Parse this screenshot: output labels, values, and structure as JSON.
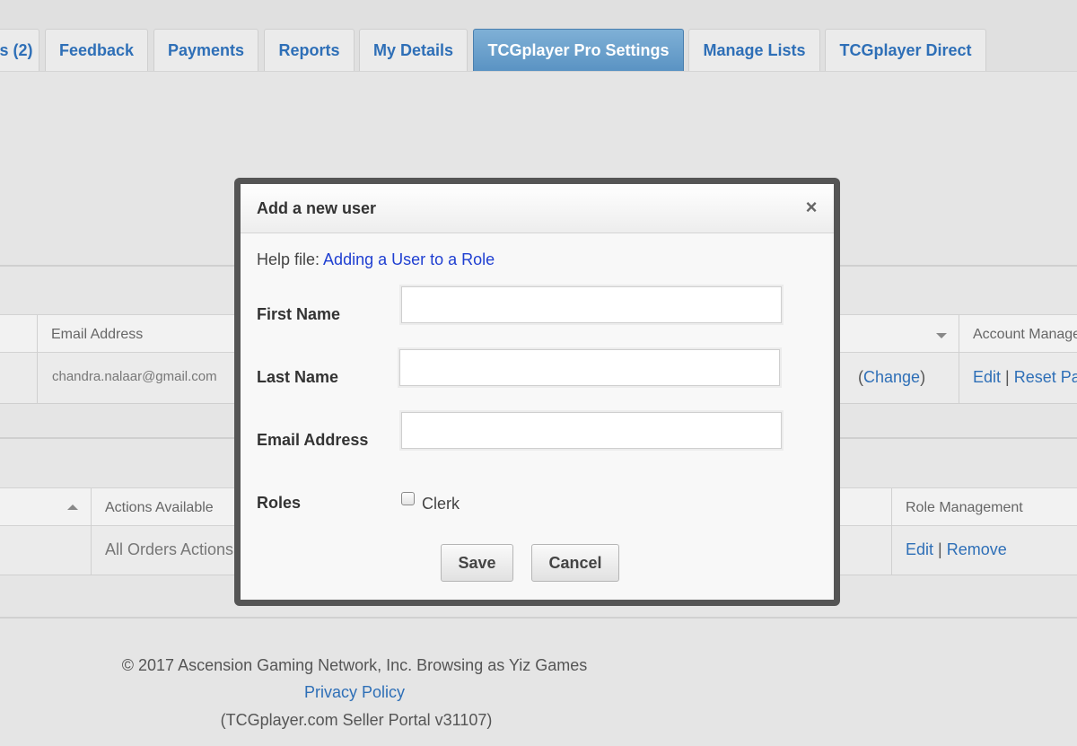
{
  "tabs": [
    {
      "label": "s (2)",
      "active": false
    },
    {
      "label": "Feedback",
      "active": false
    },
    {
      "label": "Payments",
      "active": false
    },
    {
      "label": "Reports",
      "active": false
    },
    {
      "label": "My Details",
      "active": false
    },
    {
      "label": "TCGplayer Pro Settings",
      "active": true
    },
    {
      "label": "Manage Lists",
      "active": false
    },
    {
      "label": "TCGplayer Direct",
      "active": false
    }
  ],
  "users_table": {
    "headers": {
      "email": "Email Address",
      "account": "Account Manage"
    },
    "row": {
      "email": "chandra.nalaar@gmail.com",
      "change_open": "(",
      "change": "Change",
      "change_close": ")",
      "edit": "Edit",
      "separator": "|",
      "reset": "Reset Pa"
    }
  },
  "roles_table": {
    "headers": {
      "actions": "Actions Available",
      "role_management": "Role Management"
    },
    "row": {
      "actions": "All Orders Actions",
      "edit": "Edit",
      "separator": "|",
      "remove": "Remove"
    }
  },
  "footer": {
    "copyright": "© 2017 Ascension Gaming Network, Inc. Browsing as Yiz Games",
    "privacy": "Privacy Policy",
    "version": "(TCGplayer.com Seller Portal v31107)"
  },
  "modal": {
    "title": "Add a new user",
    "close_icon": "×",
    "help_prefix": "Help file:",
    "help_link": "Adding a User to a Role",
    "fields": {
      "first_name": {
        "label": "First Name",
        "value": ""
      },
      "last_name": {
        "label": "Last Name",
        "value": ""
      },
      "email": {
        "label": "Email Address",
        "value": ""
      }
    },
    "roles_label": "Roles",
    "role_option": {
      "label": "Clerk",
      "checked": false
    },
    "save_label": "Save",
    "cancel_label": "Cancel"
  },
  "colors": {
    "link": "#2e6fb7",
    "active_tab": "#5a93c3",
    "modal_frame": "#555555",
    "help_link": "#1f3fd1"
  }
}
